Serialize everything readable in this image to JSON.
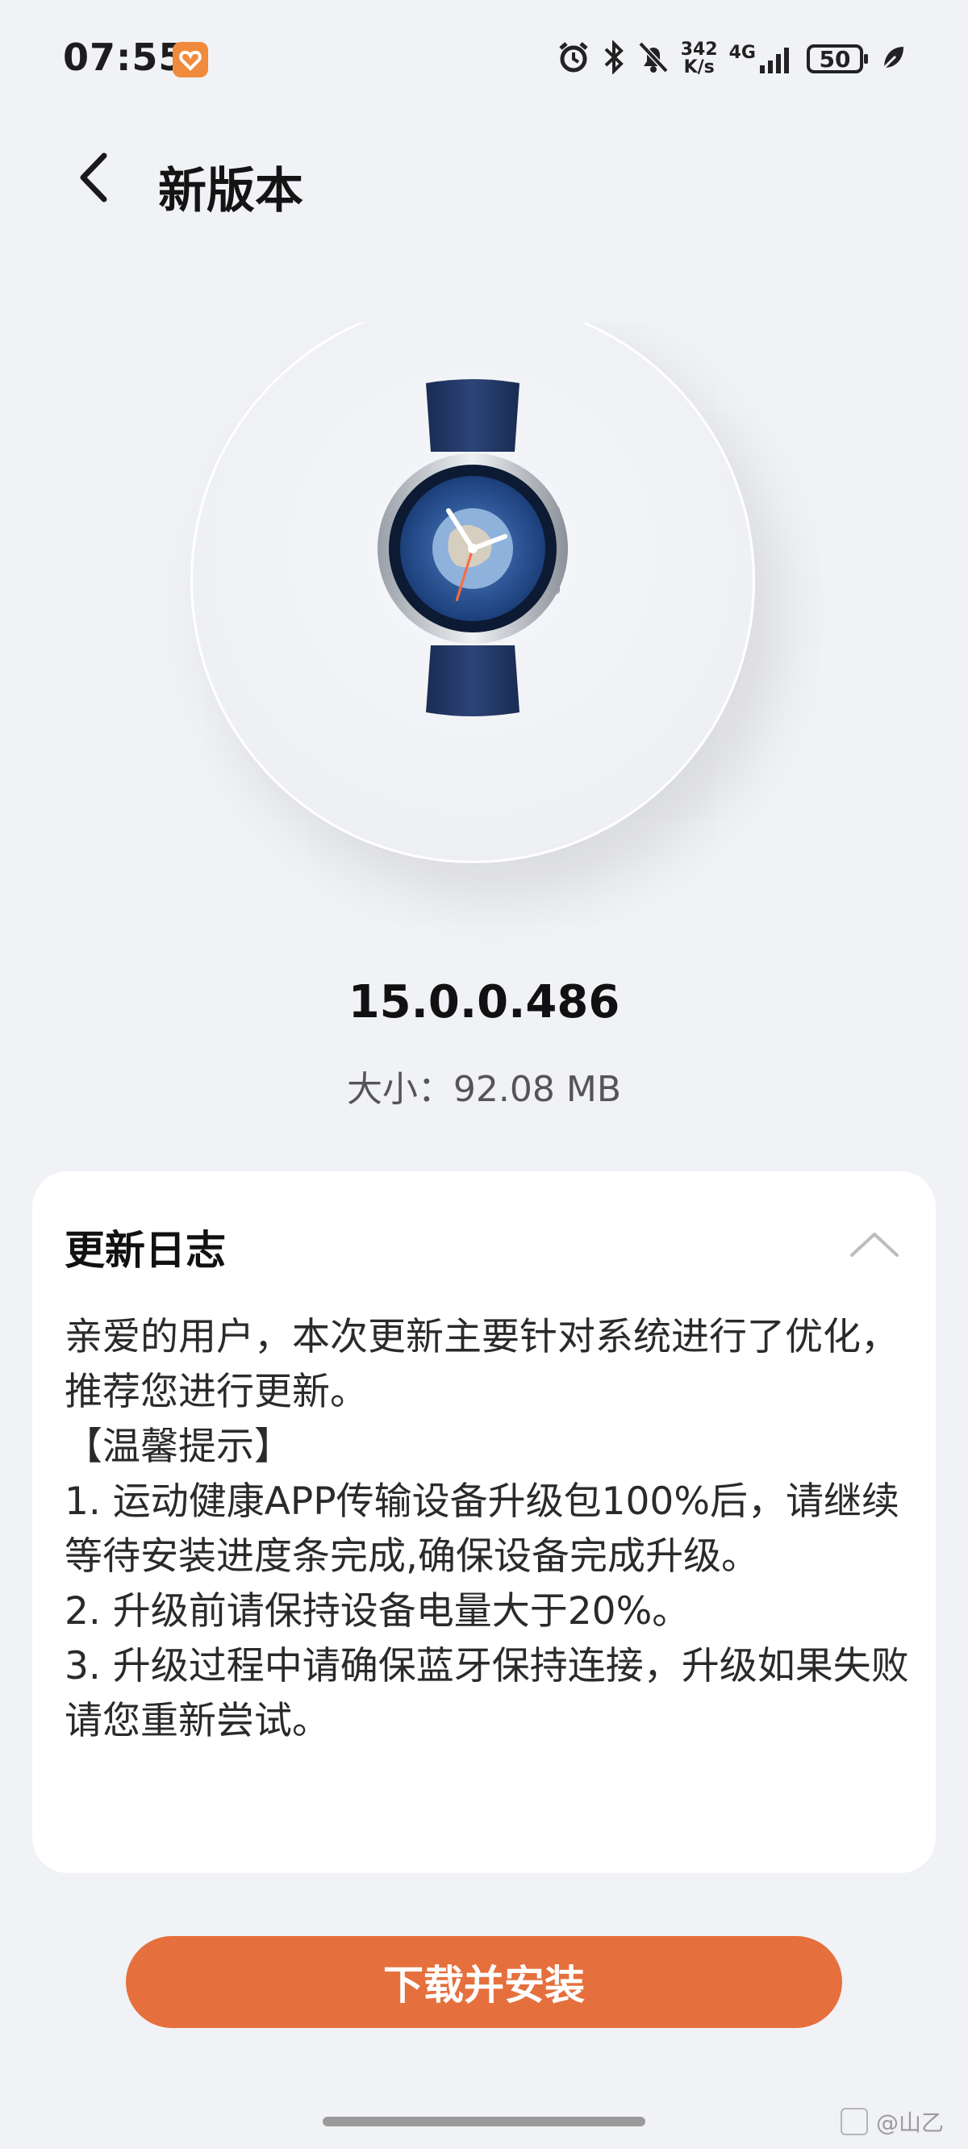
{
  "status_bar": {
    "time": "07:55",
    "net_speed_value": "342",
    "net_speed_unit": "K/s",
    "network_type": "4G",
    "battery_level": "50",
    "icons": [
      "app-badge-icon",
      "alarm-icon",
      "bluetooth-icon",
      "mute-bell-icon",
      "signal-icon",
      "battery-icon",
      "leaf-icon"
    ]
  },
  "header": {
    "title": "新版本"
  },
  "update": {
    "version": "15.0.0.486",
    "size_text": "大小：92.08 MB"
  },
  "changelog": {
    "title": "更新日志",
    "lines": [
      "亲爱的用户，本次更新主要针对系统进行了优化，推荐您进行更新。",
      "【温馨提示】",
      "1. 运动健康APP传输设备升级包100%后，请继续等待安装进度条完成,确保设备完成升级。",
      "2. 升级前请保持设备电量大于20%。",
      "3. 升级过程中请确保蓝牙保持连接，升级如果失败请您重新尝试。"
    ]
  },
  "actions": {
    "download_install_label": "下载并安装"
  },
  "watermark": {
    "text": "@山乙"
  },
  "colors": {
    "accent": "#e5703d",
    "background": "#f1f2f6",
    "card": "#ffffff"
  }
}
